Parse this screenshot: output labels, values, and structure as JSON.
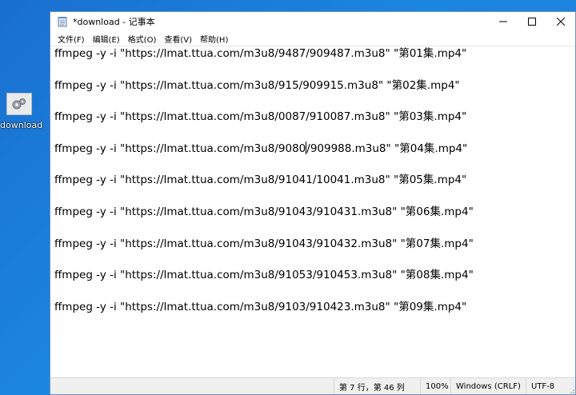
{
  "desktop": {
    "icon_label": "download"
  },
  "window": {
    "title": "*download - 记事本"
  },
  "menu": [
    "文件(F)",
    "编辑(E)",
    "格式(O)",
    "查看(V)",
    "帮助(H)"
  ],
  "editor": {
    "lines": [
      "ffmpeg -y -i \"https://lmat.ttua.com/m3u8/9487/909487.m3u8\" \"第01集.mp4\"",
      "ffmpeg -y -i \"https://lmat.ttua.com/m3u8/915/909915.m3u8\" \"第02集.mp4\"",
      "ffmpeg -y -i \"https://lmat.ttua.com/m3u8/0087/910087.m3u8\" \"第03集.mp4\"",
      "ffmpeg -y -i \"https://lmat.ttua.com/m3u8/9080/909988.m3u8\" \"第04集.mp4\"",
      "ffmpeg -y -i \"https://lmat.ttua.com/m3u8/91041/10041.m3u8\" \"第05集.mp4\"",
      "ffmpeg -y -i \"https://lmat.ttua.com/m3u8/91043/910431.m3u8\" \"第06集.mp4\"",
      "ffmpeg -y -i \"https://lmat.ttua.com/m3u8/91043/910432.m3u8\" \"第07集.mp4\"",
      "ffmpeg -y -i \"https://lmat.ttua.com/m3u8/91053/910453.m3u8\" \"第08集.mp4\"",
      "ffmpeg -y -i \"https://lmat.ttua.com/m3u8/9103/910423.m3u8\" \"第09集.mp4\""
    ]
  },
  "status": {
    "position": "第 7 行，第 46 列",
    "zoom": "100%",
    "line_ending": "Windows (CRLF)",
    "encoding": "UTF-8"
  }
}
